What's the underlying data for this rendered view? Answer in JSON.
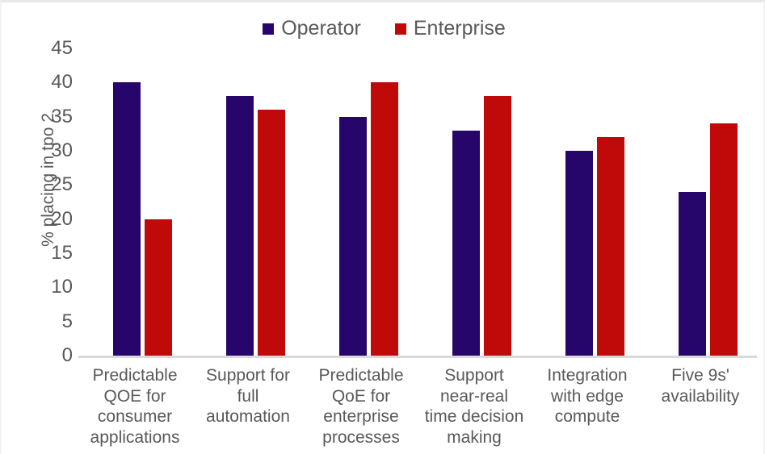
{
  "chart_data": {
    "type": "bar",
    "title": "",
    "subtitle": "",
    "xlabel": "",
    "ylabel": "% placing in tpo 2",
    "ylim": [
      0,
      45
    ],
    "ytick_step": 5,
    "yticks": [
      45,
      40,
      35,
      30,
      25,
      20,
      15,
      10,
      5,
      0
    ],
    "grid": false,
    "legend_position": "top-center",
    "categories": [
      "Predictable QOE for consumer applications",
      "Support for full automation",
      "Predictable QoE for enterprise processes",
      "Support near-real time decision making",
      "Integration with edge compute",
      "Five 9s' availability"
    ],
    "category_lines": [
      [
        "Predictable",
        "QOE for",
        "consumer",
        "applications"
      ],
      [
        "Support for",
        "full",
        "automation"
      ],
      [
        "Predictable",
        "QoE for",
        "enterprise",
        "processes"
      ],
      [
        "Support",
        "near-real",
        "time decision",
        "making"
      ],
      [
        "Integration",
        "with edge",
        "compute"
      ],
      [
        "Five 9s'",
        "availability"
      ]
    ],
    "series": [
      {
        "name": "Operator",
        "color": "#27066B",
        "values": [
          40,
          38,
          35,
          33,
          30,
          24
        ]
      },
      {
        "name": "Enterprise",
        "color": "#C00A0A",
        "values": [
          20,
          36,
          40,
          38,
          32,
          34
        ]
      }
    ]
  },
  "colors": {
    "operator": "#27066B",
    "enterprise": "#C00A0A",
    "text": "#595959",
    "axis_line": "#D9D9D9",
    "background": "#FFFFFF"
  }
}
